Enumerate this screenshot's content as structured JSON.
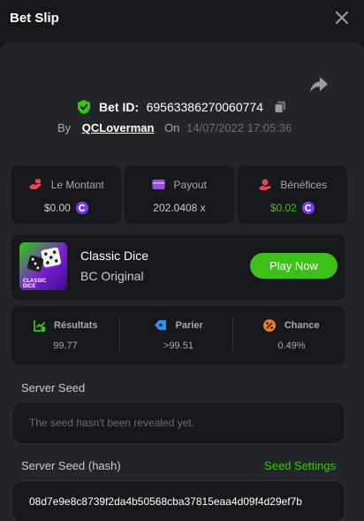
{
  "header": {
    "title": "Bet Slip",
    "close_icon": "close-icon"
  },
  "bet": {
    "id_label": "Bet ID:",
    "id_value": "69563386270060774",
    "by_label": "By",
    "username": "QCLoverman",
    "on_label": "On",
    "datetime": "14/07/2022 17:05:36"
  },
  "stats": {
    "amount": {
      "label": "Le Montant",
      "value": "$0.00"
    },
    "payout": {
      "label": "Payout",
      "value": "202.0408 x"
    },
    "profit": {
      "label": "Bénéfices",
      "value": "$0.02"
    }
  },
  "game": {
    "name": "Classic Dice",
    "provider": "BC Original",
    "play_label": "Play Now",
    "thumb_text_line1": "CLASSIC",
    "thumb_text_line2": "DICE"
  },
  "results": {
    "result": {
      "label": "Résultats",
      "value": "99.77"
    },
    "bet": {
      "label": "Parier",
      "value": ">99.51"
    },
    "chance": {
      "label": "Chance",
      "value": "0.49%"
    }
  },
  "server_seed": {
    "label": "Server Seed",
    "value": "The seed hasn't been revealed yet."
  },
  "server_seed_hash": {
    "label": "Server Seed (hash)",
    "settings_label": "Seed Settings",
    "value": "08d7e9e8c8739f2da4b50568cba37815eaa4d09f4d29ef7b"
  },
  "colors": {
    "accent_green": "#3bc117",
    "profit_green": "#3bc117",
    "coin_purple": "#7b3cf0",
    "panel_bg": "#232529",
    "card_bg": "#17181b"
  }
}
